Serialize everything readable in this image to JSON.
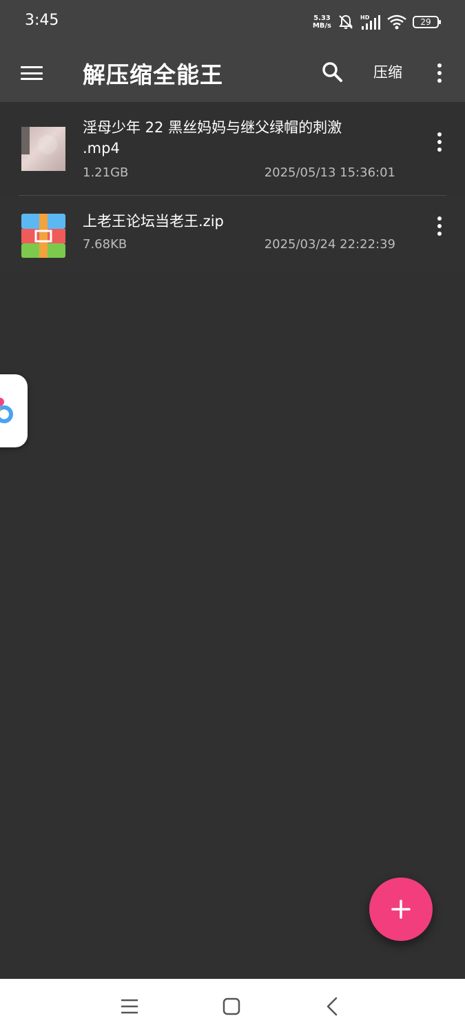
{
  "status_bar": {
    "time": "3:45",
    "net_speed_value": "5.33",
    "net_speed_unit": "MB/s",
    "battery": "29",
    "icons": [
      "mute-bell-icon",
      "hd-signal-icon",
      "wifi-icon",
      "battery-icon"
    ]
  },
  "app_bar": {
    "title": "解压缩全能王",
    "compress_label": "压缩",
    "icons": [
      "menu-icon",
      "search-icon",
      "more-vert-icon"
    ]
  },
  "files": [
    {
      "name": "淫母少年 22 黑丝妈妈与继父绿帽的刺激 .mp4",
      "size": "1.21GB",
      "date": "2025/05/13 15:36:01",
      "icon": "video-thumbnail"
    },
    {
      "name": "上老王论坛当老王.zip",
      "size": "7.68KB",
      "date": "2025/03/24 22:22:39",
      "icon": "zip-archive-icon"
    }
  ],
  "fab": {
    "icon": "plus-icon",
    "color": "#f23e7c"
  },
  "nav_bar": {
    "icons": [
      "recent-apps-icon",
      "home-icon",
      "back-icon"
    ]
  },
  "colors": {
    "background": "#303030",
    "app_bar": "#424242",
    "accent": "#f23e7c"
  }
}
